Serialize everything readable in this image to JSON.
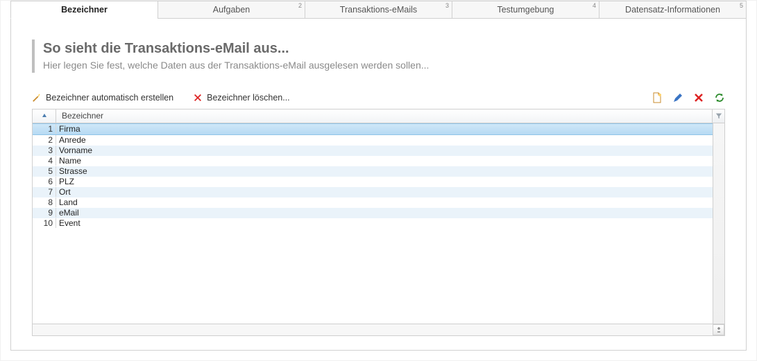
{
  "tabs": [
    {
      "label": "Bezeichner",
      "active": true
    },
    {
      "label": "Aufgaben",
      "sup": "2"
    },
    {
      "label": "Transaktions-eMails",
      "sup": "3"
    },
    {
      "label": "Testumgebung",
      "sup": "4"
    },
    {
      "label": "Datensatz-Informationen",
      "sup": "5"
    }
  ],
  "heading": {
    "title": "So sieht die Transaktions-eMail aus...",
    "subtitle": "Hier legen Sie fest, welche Daten aus der Transaktions-eMail ausgelesen werden sollen..."
  },
  "toolbar": {
    "auto_create": "Bezeichner automatisch erstellen",
    "delete": "Bezeichner löschen..."
  },
  "grid": {
    "column_header": "Bezeichner",
    "rows": [
      {
        "n": "1",
        "name": "Firma",
        "selected": true
      },
      {
        "n": "2",
        "name": "Anrede"
      },
      {
        "n": "3",
        "name": "Vorname"
      },
      {
        "n": "4",
        "name": "Name"
      },
      {
        "n": "5",
        "name": "Strasse"
      },
      {
        "n": "6",
        "name": "PLZ"
      },
      {
        "n": "7",
        "name": "Ort"
      },
      {
        "n": "8",
        "name": "Land"
      },
      {
        "n": "9",
        "name": "eMail"
      },
      {
        "n": "10",
        "name": "Event"
      }
    ]
  }
}
